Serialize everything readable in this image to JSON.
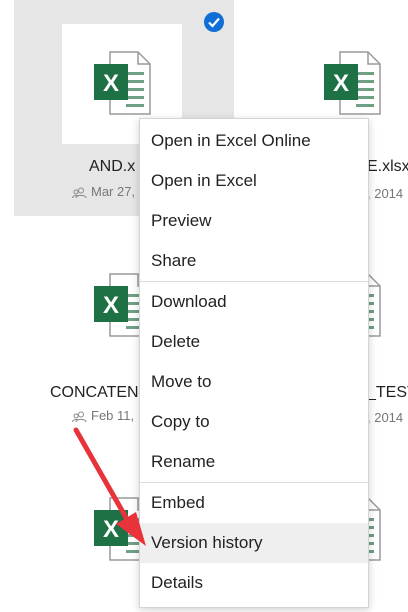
{
  "files": [
    {
      "name": "AND.x",
      "meta": "Mar 27,",
      "selected": true
    },
    {
      "name": "E.xlsx",
      "meta": ", 2014"
    },
    {
      "name": "CONCATEN",
      "meta": "Feb 11,"
    },
    {
      "name": "_TEST",
      "meta": ", 2014"
    }
  ],
  "icons": {
    "excel": "excel-file-icon",
    "shared": "shared-people-icon",
    "check": "checkmark-icon"
  },
  "colors": {
    "excel_green": "#1e7145",
    "selection_bg": "#e6e6e6",
    "check_blue": "#0f6fd6",
    "arrow_red": "#e8333a"
  },
  "menu": {
    "items": [
      "Open in Excel Online",
      "Open in Excel",
      "Preview",
      "Share",
      "Download",
      "Delete",
      "Move to",
      "Copy to",
      "Rename",
      "Embed",
      "Version history",
      "Details"
    ],
    "highlighted": "Version history"
  }
}
